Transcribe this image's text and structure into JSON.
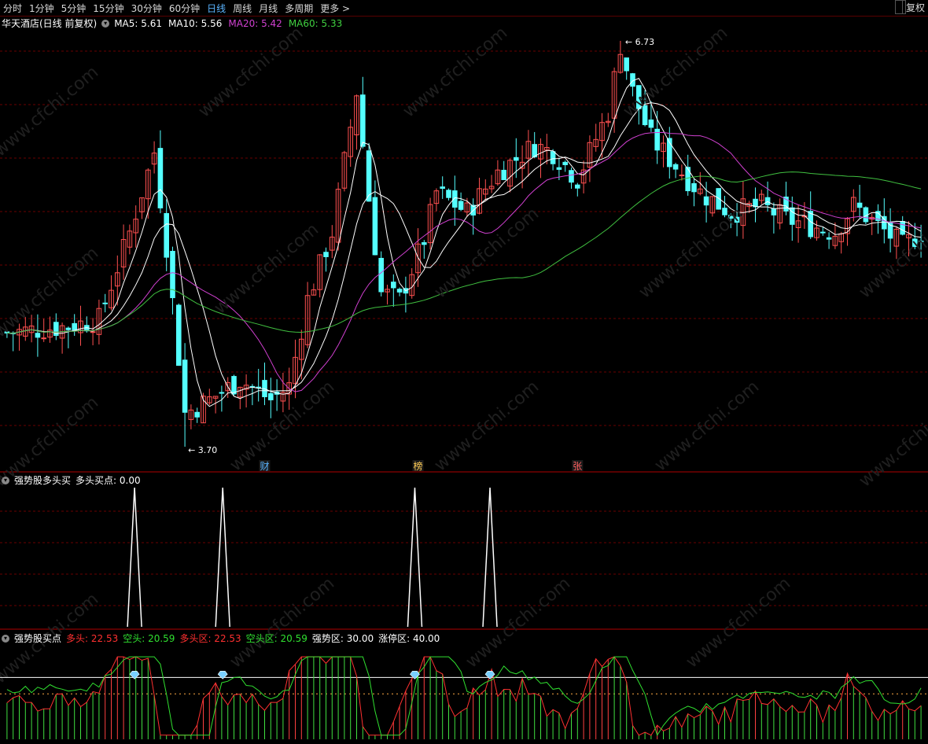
{
  "toolbar": {
    "tabs": [
      "分时",
      "1分钟",
      "5分钟",
      "15分钟",
      "30分钟",
      "60分钟",
      "日线",
      "周线",
      "月线",
      "多周期",
      "更多 >"
    ],
    "active_tab": "日线",
    "right_button": "复权"
  },
  "main_panel": {
    "title": "华天酒店(日线 前复权)",
    "ma": [
      {
        "label": "MA5: 5.61",
        "color": "#ffffff"
      },
      {
        "label": "MA10: 5.56",
        "color": "#ffffff"
      },
      {
        "label": "MA20: 5.42",
        "color": "#d040d0"
      },
      {
        "label": "MA60: 5.33",
        "color": "#40d040"
      }
    ],
    "high_label": "6.73",
    "low_label": "3.70",
    "event_markers": [
      "财",
      "榜",
      "张"
    ],
    "watermark": "www.cfchi.com"
  },
  "panel2": {
    "title": "强势股多头买",
    "value_label": "多头买点: 0.00"
  },
  "panel3": {
    "title": "强势股买点",
    "items": [
      {
        "label": "多头: 22.53",
        "color": "#ff3030"
      },
      {
        "label": "空头: 20.59",
        "color": "#30e030"
      },
      {
        "label": "多头区: 22.53",
        "color": "#ff3030"
      },
      {
        "label": "空头区: 20.59",
        "color": "#30e030"
      },
      {
        "label": "强势区: 30.00",
        "color": "#ffffff"
      },
      {
        "label": "涨停区: 40.00",
        "color": "#ffffff"
      }
    ]
  },
  "colors": {
    "up": "#ff5050",
    "down": "#54ffff",
    "ma5": "#ffffff",
    "ma10": "#ffffff",
    "ma20": "#d040d0",
    "ma60": "#40c040",
    "grid": "#6a0000"
  },
  "chart_data": [
    {
      "type": "candlestick",
      "title": "华天酒店(日线 前复权)",
      "ylim": [
        3.6,
        6.8
      ],
      "high": 6.73,
      "low": 3.7,
      "ma_last": {
        "MA5": 5.61,
        "MA10": 5.56,
        "MA20": 5.42,
        "MA60": 5.33
      }
    },
    {
      "type": "line",
      "title": "强势股多头买",
      "series": [
        {
          "name": "多头买点",
          "last": 0.0
        }
      ],
      "spikes_at_fraction": [
        0.145,
        0.24,
        0.447,
        0.528
      ]
    },
    {
      "type": "bar",
      "title": "强势股买点",
      "series": [
        {
          "name": "多头",
          "last": 22.53
        },
        {
          "name": "空头",
          "last": 20.59
        }
      ],
      "levels": {
        "强势区": 30.0,
        "涨停区": 40.0
      }
    }
  ]
}
